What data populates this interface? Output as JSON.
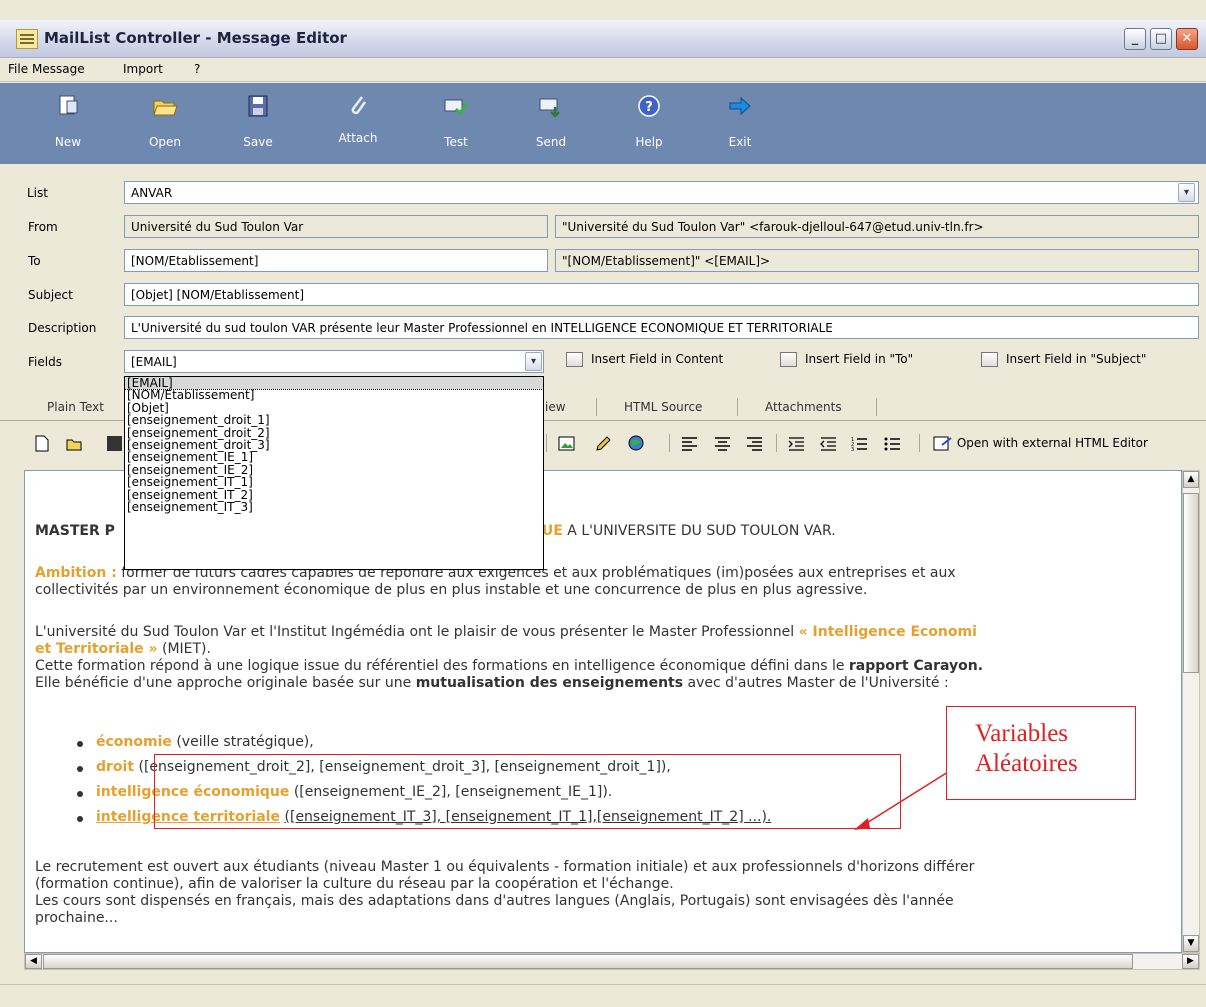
{
  "window": {
    "title": "MailList Controller - Message Editor"
  },
  "menu": [
    "File",
    "Message",
    "Import",
    "?"
  ],
  "toolbar": [
    {
      "label": "New",
      "icon": "new-icon"
    },
    {
      "label": "Open",
      "icon": "open-folder-icon"
    },
    {
      "label": "Save",
      "icon": "save-icon"
    },
    {
      "label": "Attach",
      "icon": "paperclip-icon"
    },
    {
      "label": "Test",
      "icon": "test-mail-icon"
    },
    {
      "label": "Send",
      "icon": "send-mail-icon"
    },
    {
      "label": "Help",
      "icon": "help-icon"
    },
    {
      "label": "Exit",
      "icon": "exit-arrow-icon"
    }
  ],
  "form": {
    "list_label": "List",
    "list_value": "ANVAR",
    "from_label": "From",
    "from_value": "Université du Sud Toulon Var",
    "from_full": "\"Université du Sud Toulon Var\" <farouk-djelloul-647@etud.univ-tln.fr>",
    "to_label": "To",
    "to_value": "[NOM/Etablissement]",
    "to_full": "\"[NOM/Etablissement]\" <[EMAIL]>",
    "subject_label": "Subject",
    "subject_value": "[Objet] [NOM/Etablissement]",
    "description_label": "Description",
    "description_value": "L'Université du sud toulon VAR présente leur Master Professionnel en INTELLIGENCE ECONOMIQUE ET TERRITORIALE",
    "fields_label": "Fields",
    "fields_value": "[EMAIL]",
    "insert_content": "Insert Field in Content",
    "insert_to": "Insert Field in \"To\"",
    "insert_subject": "Insert Field in \"Subject\""
  },
  "fields_options": [
    "[EMAIL]",
    "[NOM/Etablissement]",
    "[Objet]",
    "[enseignement_droit_1]",
    "[enseignement_droit_2]",
    "[enseignement_droit_3]",
    "[enseignement_IE_1]",
    "[enseignement_IE_2]",
    "[enseignement_IT_1]",
    "[enseignement_IT_2]",
    "[enseignement_IT_3]"
  ],
  "tabs": {
    "plain": "Plain Text",
    "preview": "iew",
    "source": "HTML Source",
    "attach": "Attachments"
  },
  "editor_toolbar": {
    "external": "Open with external HTML Editor"
  },
  "content": {
    "heading_a": "MASTER P",
    "heading_b": "QUE",
    "heading_c": "A L'UNIVERSITE DU SUD TOULON VAR.",
    "ambition_label": "Ambition :",
    "ambition_1": "former de futurs cadres capables de répondre aux exigences et aux problématiques (im)posées aux entreprises et aux",
    "ambition_2": "collectivités par un environnement économique de plus en plus instable et une concurrence de plus en plus agressive.",
    "p2_1": "L'université du Sud Toulon Var et l'Institut Ingémédia ont le plaisir de vous présenter le Master Professionnel",
    "p2_1b": "« Intelligence Economi",
    "p2_2a": "et Territoriale »",
    "p2_2b": "(MIET).",
    "p2_3a": "Cette formation répond à une logique issue du référentiel des formations en intelligence économique défini dans le",
    "p2_3b": "rapport Carayon.",
    "p2_4a": "Elle bénéficie d'une approche originale basée sur une",
    "p2_4b": "mutualisation des enseignements",
    "p2_4c": "avec d'autres Master de l'Université :",
    "b1a": "économie",
    "b1b": "(veille stratégique),",
    "b2a": "droit",
    "b2b": "([enseignement_droit_2], [enseignement_droit_3], [enseignement_droit_1]),",
    "b3a": "intelligence économique",
    "b3b": "([enseignement_IE_2], [enseignement_IE_1]).",
    "b4a": "intelligence territoriale",
    "b4b": "([enseignement_IT_3], [enseignement_IT_1],[enseignement_IT_2] ...).",
    "p3_1": "Le recrutement est ouvert aux étudiants (niveau Master 1 ou équivalents - formation initiale) et aux professionnels d'horizons différer",
    "p3_2": "(formation continue), afin de valoriser la culture du réseau par la coopération et l'échange.",
    "p3_3": "Les cours sont dispensés en français, mais des adaptations dans d'autres langues (Anglais, Portugais) sont envisagées dès l'année",
    "p3_4": "prochaine..."
  },
  "annotation": {
    "line1": "Variables",
    "line2": "Aléatoires",
    "color": "#e02020"
  },
  "colors": {
    "toolbar": "#6e88b0",
    "accent": "#e4a12f"
  }
}
